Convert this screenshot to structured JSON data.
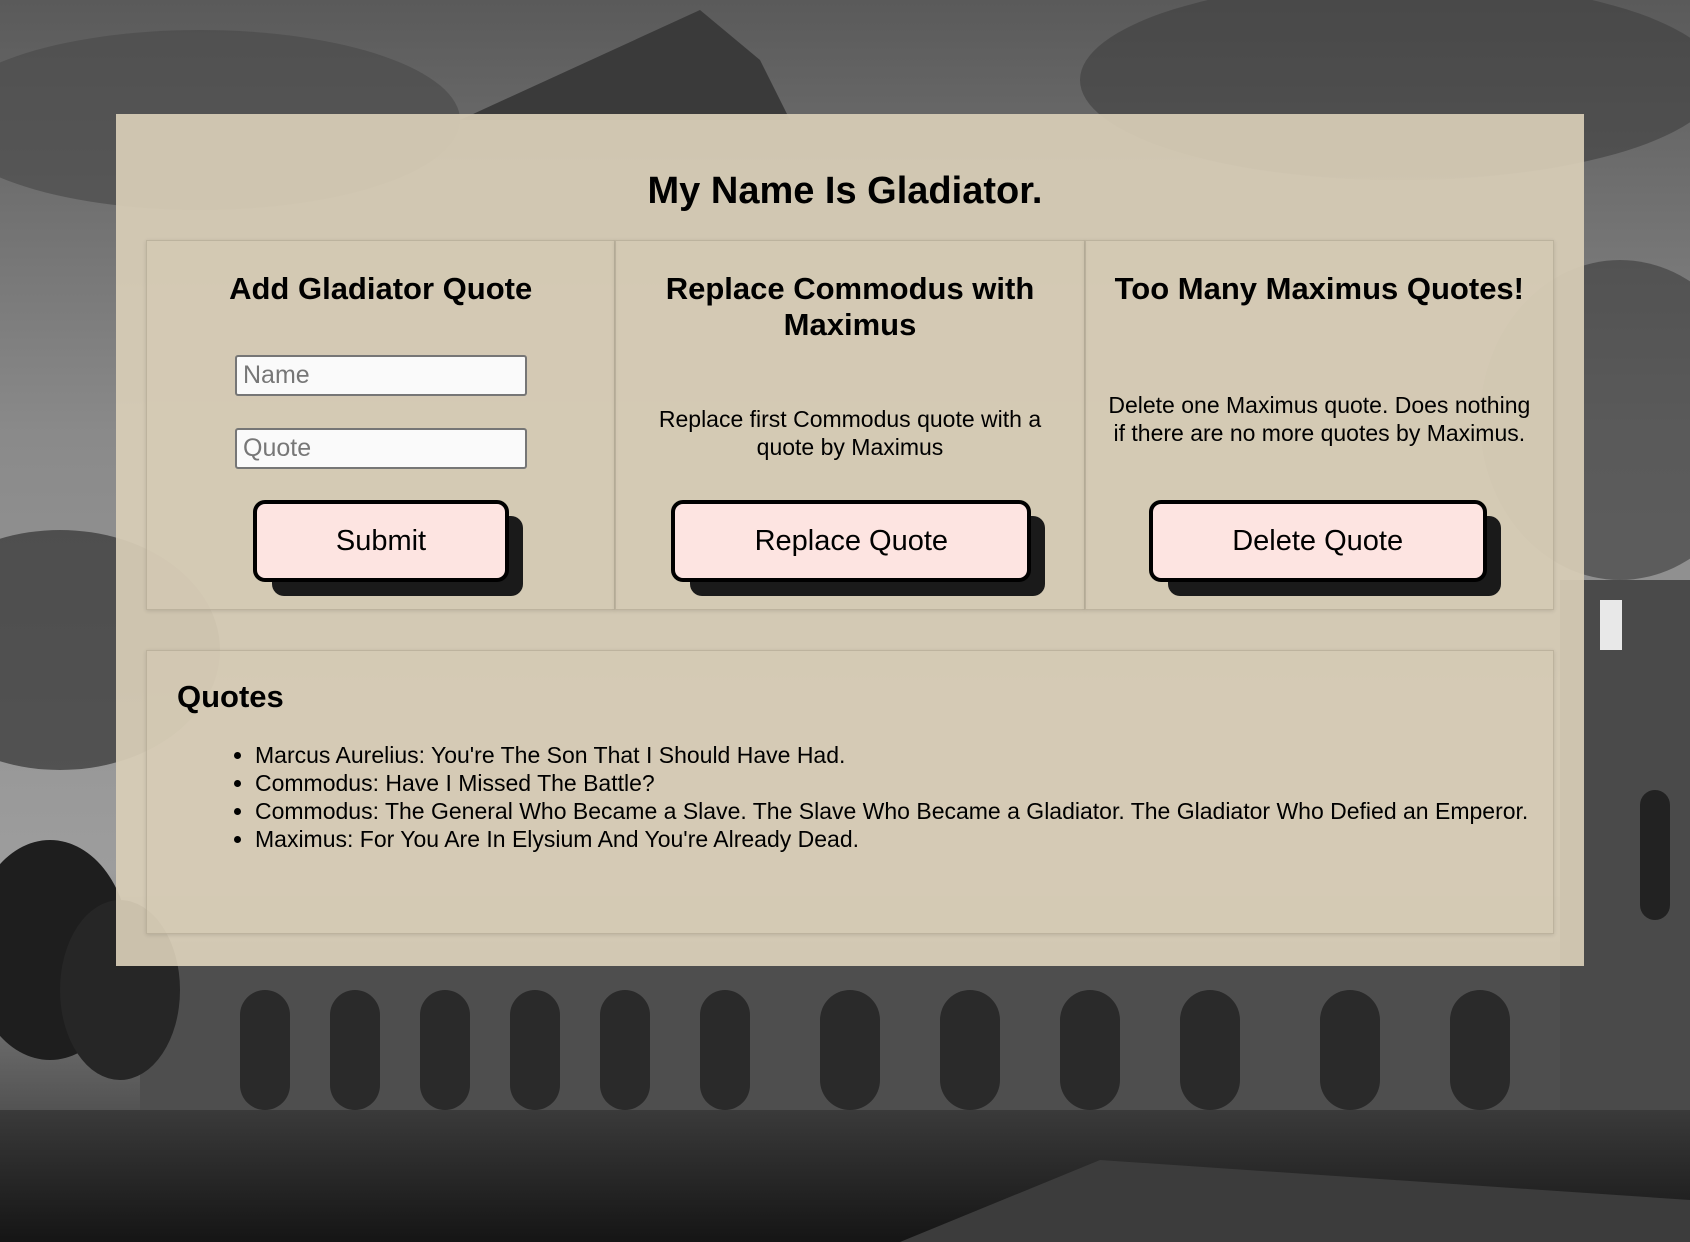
{
  "title": "My Name Is Gladiator.",
  "add_card": {
    "heading": "Add Gladiator Quote",
    "name_placeholder": "Name",
    "quote_placeholder": "Quote",
    "submit_label": "Submit"
  },
  "replace_card": {
    "heading": "Replace Commodus with Maximus",
    "description": "Replace first Commodus quote with a quote by Maximus",
    "button_label": "Replace Quote"
  },
  "delete_card": {
    "heading": "Too Many Maximus Quotes!",
    "description": "Delete one Maximus quote. Does nothing if there are no more quotes by Maximus.",
    "button_label": "Delete Quote"
  },
  "quotes": {
    "heading": "Quotes",
    "items": [
      "Marcus Aurelius: You're The Son That I Should Have Had.",
      "Commodus: Have I Missed The Battle?",
      "Commodus: The General Who Became a Slave. The Slave Who Became a Gladiator. The Gladiator Who Defied an Emperor.",
      "Maximus: For You Are In Elysium And You're Already Dead."
    ]
  },
  "colors": {
    "panel": "#d8cdb7",
    "button": "#fde4e1",
    "button_shadow": "#1a1a1a"
  }
}
